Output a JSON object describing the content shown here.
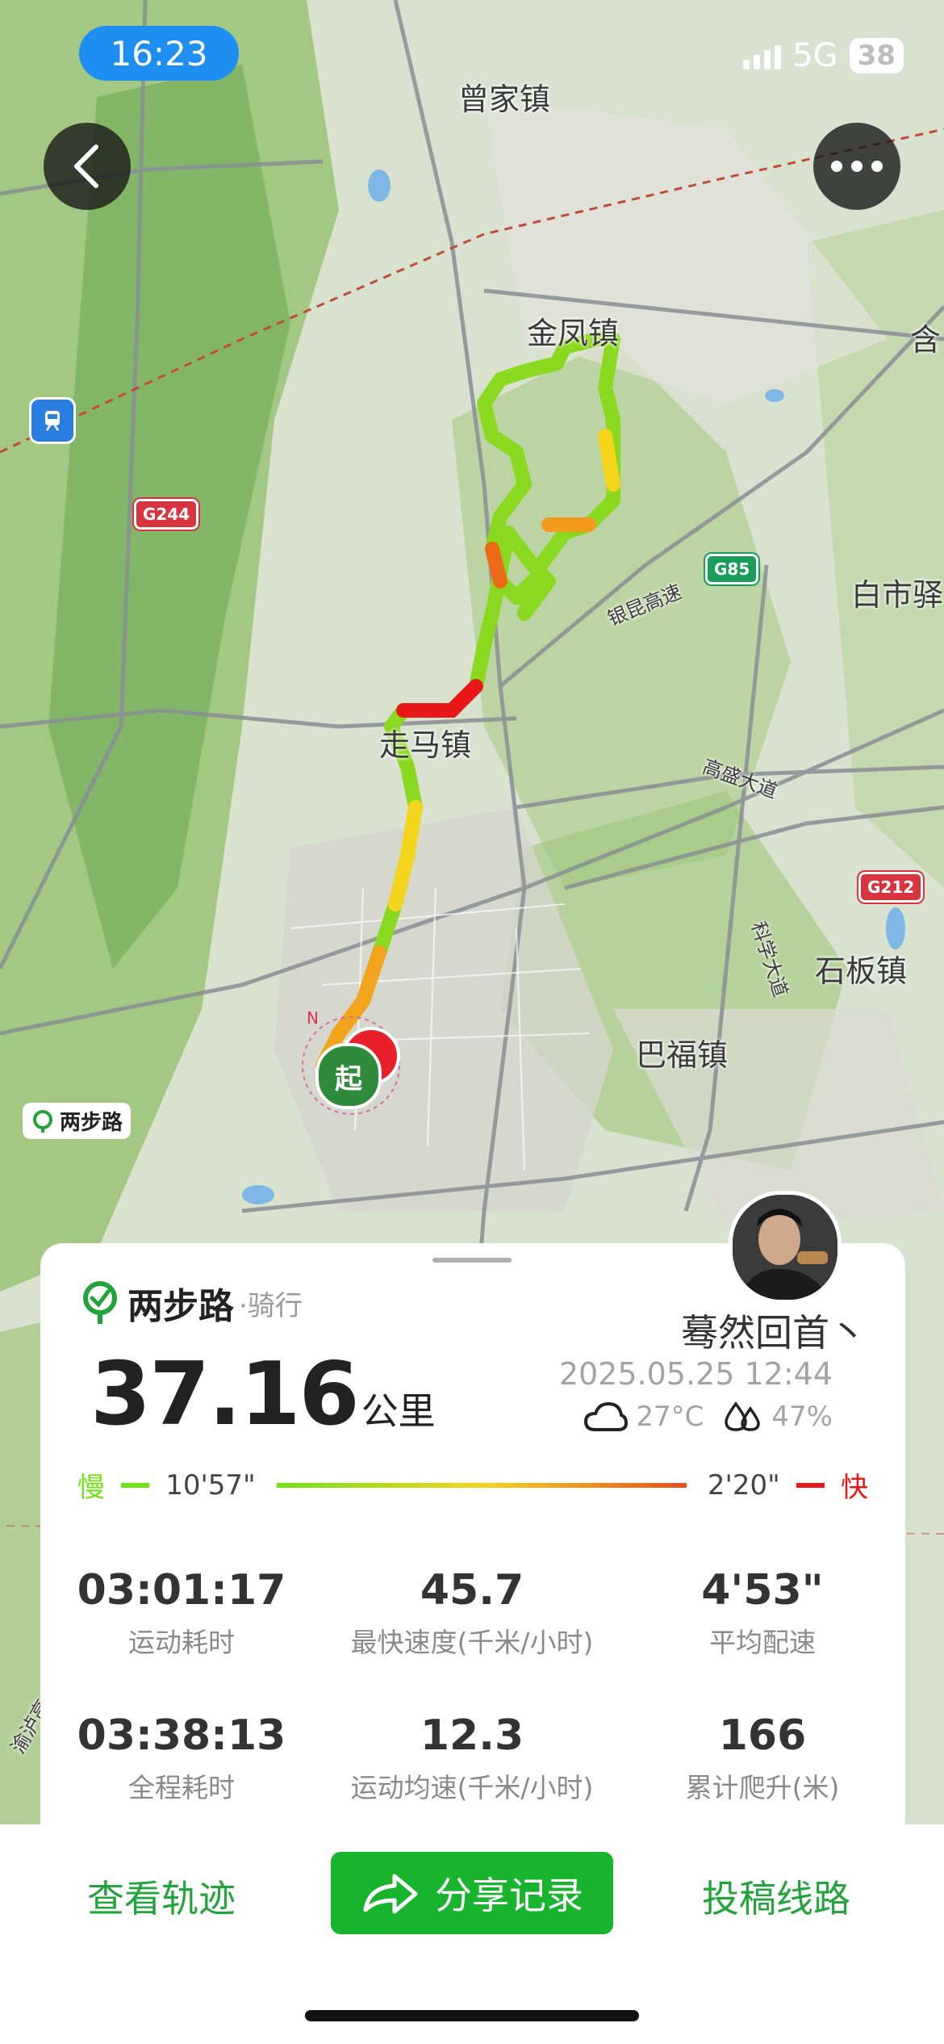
{
  "status_bar": {
    "time": "16:23",
    "network": "5G",
    "battery": "38"
  },
  "map": {
    "places": {
      "zengjia": "曾家镇",
      "jinfeng": "金凤镇",
      "zouma": "走马镇",
      "bashi": "白市驿",
      "shiban": "石板镇",
      "bafu": "巴福镇",
      "han": "含",
      "yinkun": "银昆高速",
      "gaosheng": "高盛大道",
      "kexue": "科学大道",
      "yuzhan": "渝泸高"
    },
    "road_badges": {
      "g244": "G244",
      "g85": "G85",
      "g212": "G212"
    },
    "start_marker": "起",
    "compass": "N",
    "watermark": "两步路"
  },
  "card": {
    "brand": "两步路",
    "activity": "·骑行",
    "user_name": "蓦然回首丶",
    "distance": "37.16",
    "distance_unit": "公里",
    "datetime": "2025.05.25 12:44",
    "temperature": "27°C",
    "humidity": "47%",
    "legend": {
      "slow": "慢",
      "slow_pace": "10'57\"",
      "fast_pace": "2'20\"",
      "fast": "快"
    },
    "stats": [
      {
        "value": "03:01:17",
        "label": "运动耗时"
      },
      {
        "value": "45.7",
        "label": "最快速度(千米/小时)"
      },
      {
        "value": "4'53\"",
        "label": "平均配速"
      },
      {
        "value": "03:38:13",
        "label": "全程耗时"
      },
      {
        "value": "12.3",
        "label": "运动均速(千米/小时)"
      },
      {
        "value": "166",
        "label": "累计爬升(米)"
      }
    ]
  },
  "actions": {
    "view_track": "查看轨迹",
    "share": "分享记录",
    "submit_route": "投稿线路"
  },
  "colors": {
    "accent": "#19b42e",
    "slow": "#6fe314",
    "fast": "#e81818",
    "status_pill": "#1f8ef2"
  }
}
